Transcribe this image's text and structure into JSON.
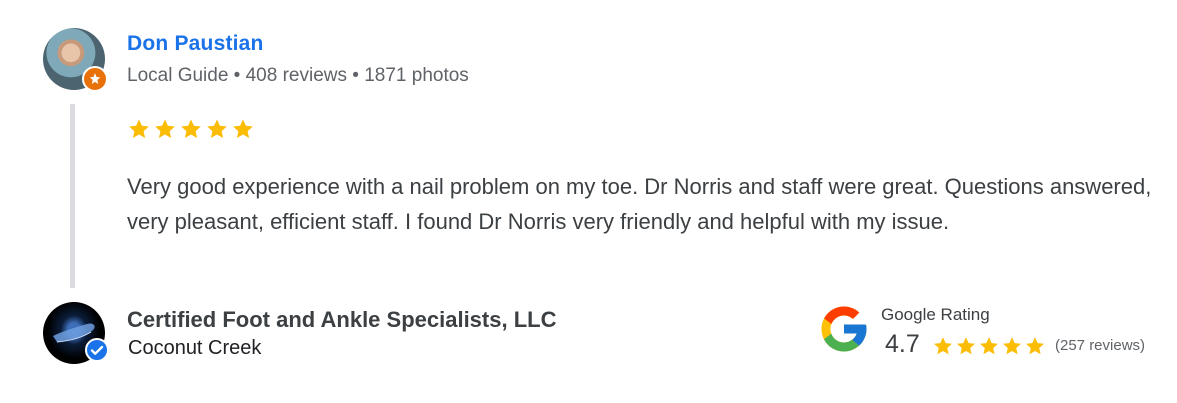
{
  "reviewer": {
    "name": "Don Paustian",
    "meta": "Local Guide • 408 reviews • 1871 photos",
    "avatar_icon": "person-photo-icon",
    "badge_icon": "local-guide-badge-icon"
  },
  "review": {
    "rating": 5,
    "max_rating": 5,
    "text": "Very good experience with a nail problem on my toe. Dr Norris and staff were great. Questions answered, very pleasant, efficient staff. I found Dr Norris very friendly and helpful with my issue."
  },
  "business": {
    "name": "Certified Foot and Ankle Specialists, LLC",
    "location": "Coconut Creek",
    "logo_icon": "foot-logo-icon",
    "verified_icon": "verified-check-icon"
  },
  "google_rating": {
    "label": "Google Rating",
    "value": "4.7",
    "stars": 5,
    "count": "(257 reviews)",
    "logo_icon": "google-g-icon"
  },
  "colors": {
    "name_link": "#1a73e8",
    "star": "#fbbc04",
    "guide_badge": "#e8710a",
    "verified": "#1a73e8",
    "quote_bar": "#dadce0"
  }
}
